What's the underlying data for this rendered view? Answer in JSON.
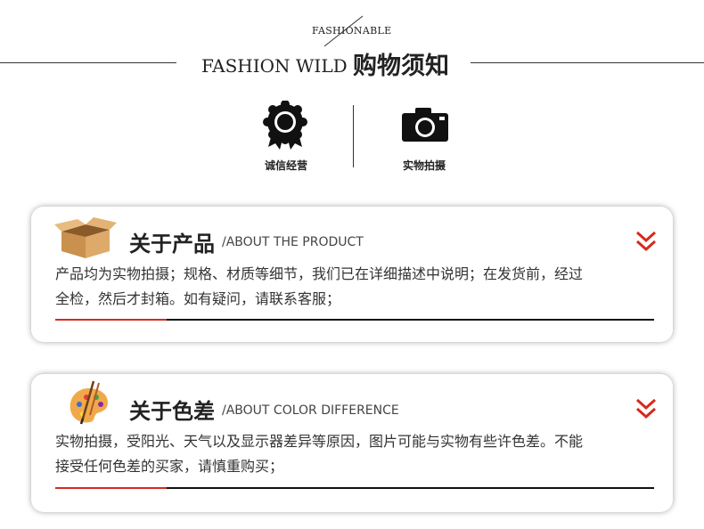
{
  "header": {
    "small_text": "FASHIONABLE",
    "main_en": "FASHION WILD",
    "main_cn": "购物须知"
  },
  "badges": [
    {
      "icon": "award-ribbon-icon",
      "label": "诚信经营"
    },
    {
      "icon": "camera-icon",
      "label": "实物拍摄"
    }
  ],
  "sections": [
    {
      "icon": "cardboard-box-icon",
      "title": "关于产品",
      "subtitle": "/ABOUT THE PRODUCT",
      "body_line1": "产品均为实物拍摄；规格、材质等细节，我们已在详细描述中说明；在发货前，经过",
      "body_line2": "全检，然后才封箱。如有疑问，请联系客服；"
    },
    {
      "icon": "paint-palette-icon",
      "title": "关于色差",
      "subtitle": "/ABOUT COLOR DIFFERENCE",
      "body_line1": "实物拍摄，受阳光、天气以及显示器差异等原因，图片可能与实物有些许色差。不能",
      "body_line2": "接受任何色差的买家，请慎重购买；"
    }
  ],
  "colors": {
    "accent": "#d62a1c",
    "text": "#222222"
  }
}
